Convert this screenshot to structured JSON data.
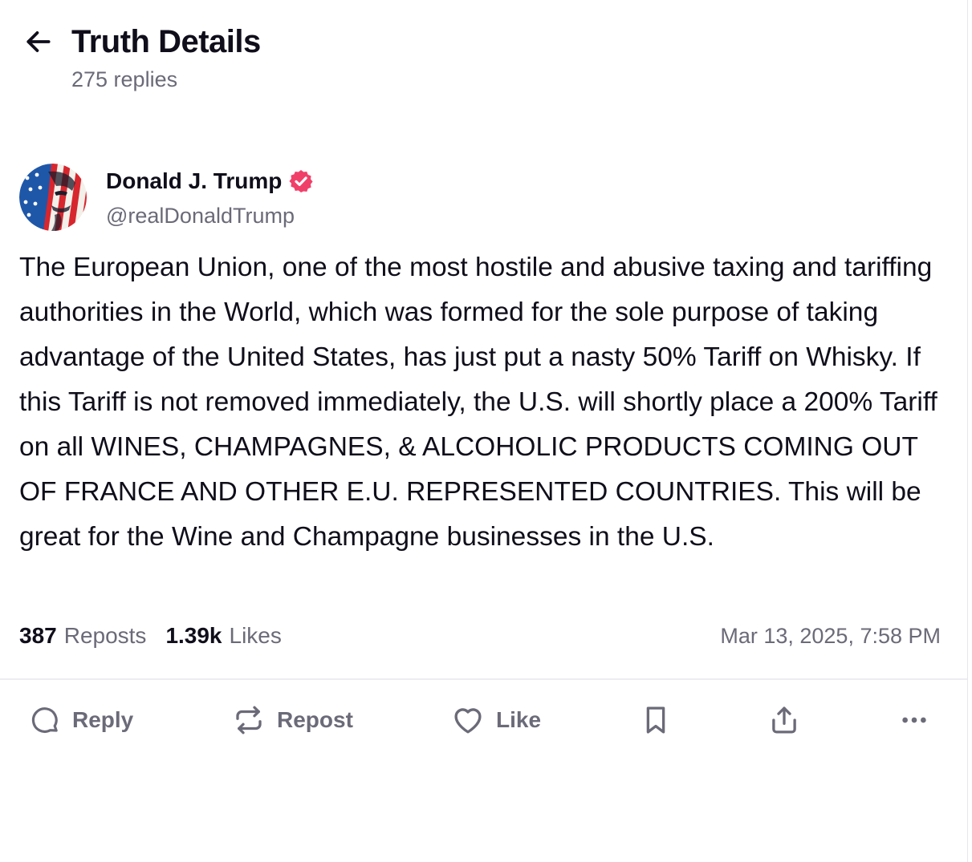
{
  "header": {
    "title": "Truth Details",
    "replies": "275 replies"
  },
  "author": {
    "name": "Donald J. Trump",
    "handle": "@realDonaldTrump",
    "verified": true
  },
  "post": {
    "text": "The European Union, one of the most hostile and abusive taxing and tariffing authorities in the World, which was formed for the sole purpose of taking advantage of the United States, has just put a nasty 50% Tariff on Whisky. If this Tariff is not removed immediately, the U.S. will shortly place a 200% Tariff on all WINES, CHAMPAGNES, & ALCOHOLIC PRODUCTS COMING OUT OF FRANCE AND OTHER E.U. REPRESENTED COUNTRIES. This will be great for the Wine and Champagne businesses in the U.S.",
    "reposts_count": "387",
    "reposts_label": "Reposts",
    "likes_count": "1.39k",
    "likes_label": "Likes",
    "timestamp": "Mar 13, 2025, 7:58 PM"
  },
  "actions": {
    "reply": "Reply",
    "repost": "Repost",
    "like": "Like"
  },
  "icons": {
    "back": "arrow-left-icon",
    "verified": "verified-badge-icon",
    "reply": "speech-bubble-icon",
    "repost": "repost-arrows-icon",
    "like": "heart-icon",
    "bookmark": "bookmark-icon",
    "share": "share-upload-icon",
    "more": "more-dots-icon"
  },
  "colors": {
    "text": "#0f0e1a",
    "muted": "#6b6a78",
    "verified": "#f0406a",
    "divider": "#ececf1"
  }
}
